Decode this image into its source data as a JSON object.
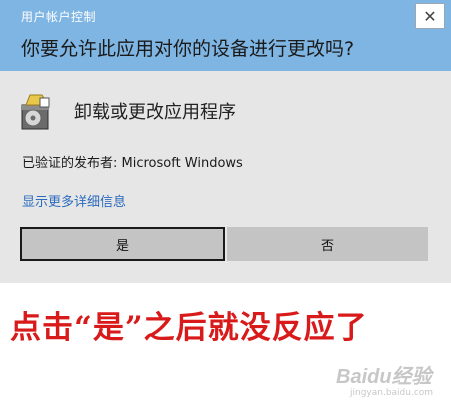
{
  "dialog": {
    "title": "用户帐户控制",
    "close_glyph": "✕",
    "question": "你要允许此应用对你的设备进行更改吗?",
    "app_name": "卸载或更改应用程序",
    "app_icon": "installer-disc-icon",
    "publisher": "已验证的发布者: Microsoft Windows",
    "details_link": "显示更多详细信息",
    "yes_label": "是",
    "no_label": "否",
    "colors": {
      "header": "#7fb5e2",
      "body": "#e6e6e6",
      "button": "#c4c4c4",
      "link": "#2a6bbd"
    }
  },
  "annotation": {
    "text": "点击“是”之后就没反应了",
    "color": "#d91a1a"
  },
  "watermark": {
    "text": "Baidu经验",
    "subtext": "jingyan.baidu.com"
  }
}
